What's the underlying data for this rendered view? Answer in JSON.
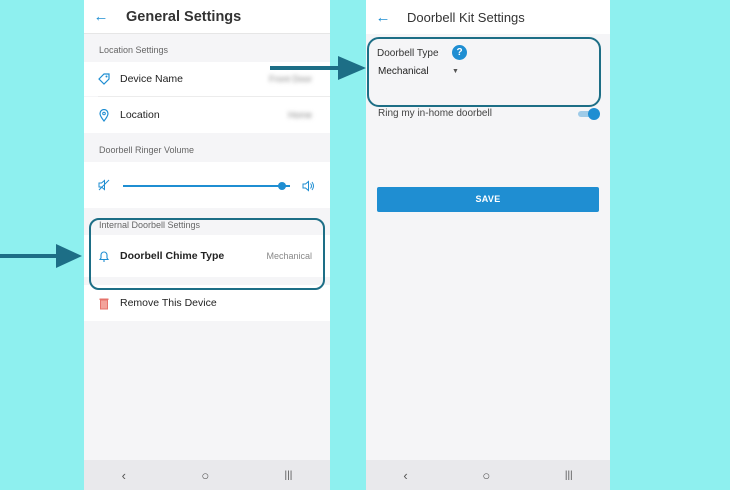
{
  "left_screen": {
    "title": "General Settings",
    "back_icon": "arrow-left-icon",
    "location_section_label": "Location Settings",
    "device_name": {
      "label": "Device Name",
      "value": "Front Door",
      "icon": "tag-icon"
    },
    "location": {
      "label": "Location",
      "value": "Home",
      "icon": "map-pin-icon"
    },
    "volume_section_label": "Doorbell Ringer Volume",
    "volume_level": 0.95,
    "internal_section_label": "Internal Doorbell Settings",
    "chime": {
      "label": "Doorbell Chime Type",
      "value": "Mechanical",
      "icon": "bell-icon"
    },
    "remove": {
      "label": "Remove This Device",
      "icon": "trash-icon"
    }
  },
  "right_screen": {
    "title": "Doorbell Kit Settings",
    "doorbell_type_label": "Doorbell Type",
    "help_glyph": "?",
    "doorbell_type_value": "Mechanical",
    "ring_label": "Ring my in-home doorbell",
    "ring_enabled": true,
    "save_label": "SAVE"
  },
  "navbar": {
    "back": "‹",
    "home": "○",
    "recents": "|||"
  },
  "colors": {
    "background": "#8ef0ef",
    "accent": "#1f8ed2",
    "highlight": "#1d6e86",
    "danger": "#e5736b"
  }
}
